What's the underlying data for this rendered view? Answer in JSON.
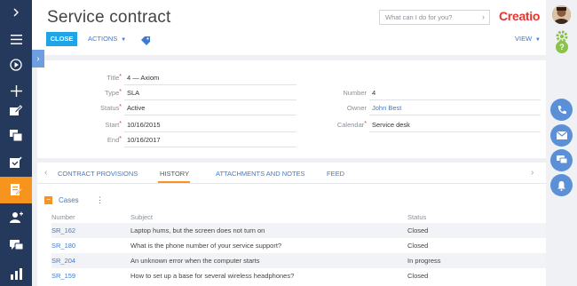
{
  "header": {
    "title": "Service contract",
    "search_placeholder": "What can I do for you?",
    "logo": "Creatio",
    "close_label": "CLOSE",
    "actions_label": "ACTIONS",
    "view_label": "VIEW"
  },
  "fields": {
    "title": {
      "label": "Title",
      "value": "4 — Axiom"
    },
    "type": {
      "label": "Type",
      "value": "SLA"
    },
    "status": {
      "label": "Status",
      "value": "Active"
    },
    "start": {
      "label": "Start",
      "value": "10/16/2015"
    },
    "end": {
      "label": "End",
      "value": "10/16/2017"
    },
    "number": {
      "label": "Number",
      "value": "4"
    },
    "owner": {
      "label": "Owner",
      "value": "John Best"
    },
    "calendar": {
      "label": "Calendar",
      "value": "Service desk"
    }
  },
  "tabs": [
    {
      "label": "CONTRACT PROVISIONS"
    },
    {
      "label": "HISTORY"
    },
    {
      "label": "ATTACHMENTS AND NOTES"
    },
    {
      "label": "FEED"
    }
  ],
  "cases": {
    "title": "Cases",
    "columns": {
      "number": "Number",
      "subject": "Subject",
      "status": "Status"
    },
    "rows": [
      {
        "number": "SR_162",
        "subject": "Laptop hums, but the screen does not turn on",
        "status": "Closed"
      },
      {
        "number": "SR_180",
        "subject": "What is the phone number of your service support?",
        "status": "Closed"
      },
      {
        "number": "SR_204",
        "subject": "An unknown error when the computer starts",
        "status": "In progress"
      },
      {
        "number": "SR_159",
        "subject": "How to set up a base for several wireless headphones?",
        "status": "Closed"
      }
    ]
  },
  "colors": {
    "nav_bg": "#25395c",
    "accent_orange": "#f7941d",
    "primary_blue": "#1fa5e6",
    "link_blue": "#3d7bd0",
    "logo_red": "#e8332e"
  },
  "icons": {
    "leftbar": [
      "expand-chevron-icon",
      "menu-icon",
      "play-icon",
      "add-icon",
      "edit-icon",
      "copy-icon",
      "tasks-icon",
      "contracts-icon",
      "contacts-icon",
      "chat-icon",
      "analytics-icon"
    ],
    "rightbar": [
      "avatar",
      "settings-gear-icon",
      "help-icon",
      "phone-icon",
      "email-icon",
      "chat-icon",
      "notifications-bell-icon"
    ]
  }
}
